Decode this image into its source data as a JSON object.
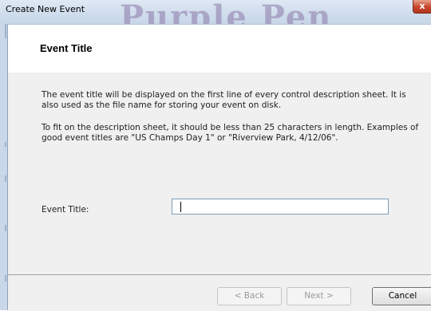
{
  "window": {
    "title": "Create New Event",
    "background_title_text": "Purple Pen",
    "close_label": "x"
  },
  "header": {
    "title": "Event Title"
  },
  "content": {
    "paragraph1": "The event title will be displayed on the first line of every control description sheet. It is also used as the file name for storing your event on disk.",
    "paragraph2": "To fit on the description sheet, it should be less than 25 characters in length. Examples of good event titles are \"US Champs Day 1\" or \"Riverview Park, 4/12/06\".",
    "field_label": "Event Title:",
    "field_value": ""
  },
  "buttons": {
    "back": "< Back",
    "next": "Next >",
    "cancel": "Cancel"
  },
  "colors": {
    "titlebar": "#cfdcec",
    "close": "#c7452b",
    "content_bg": "#f0f0f0",
    "input_border": "#7f9db9"
  }
}
